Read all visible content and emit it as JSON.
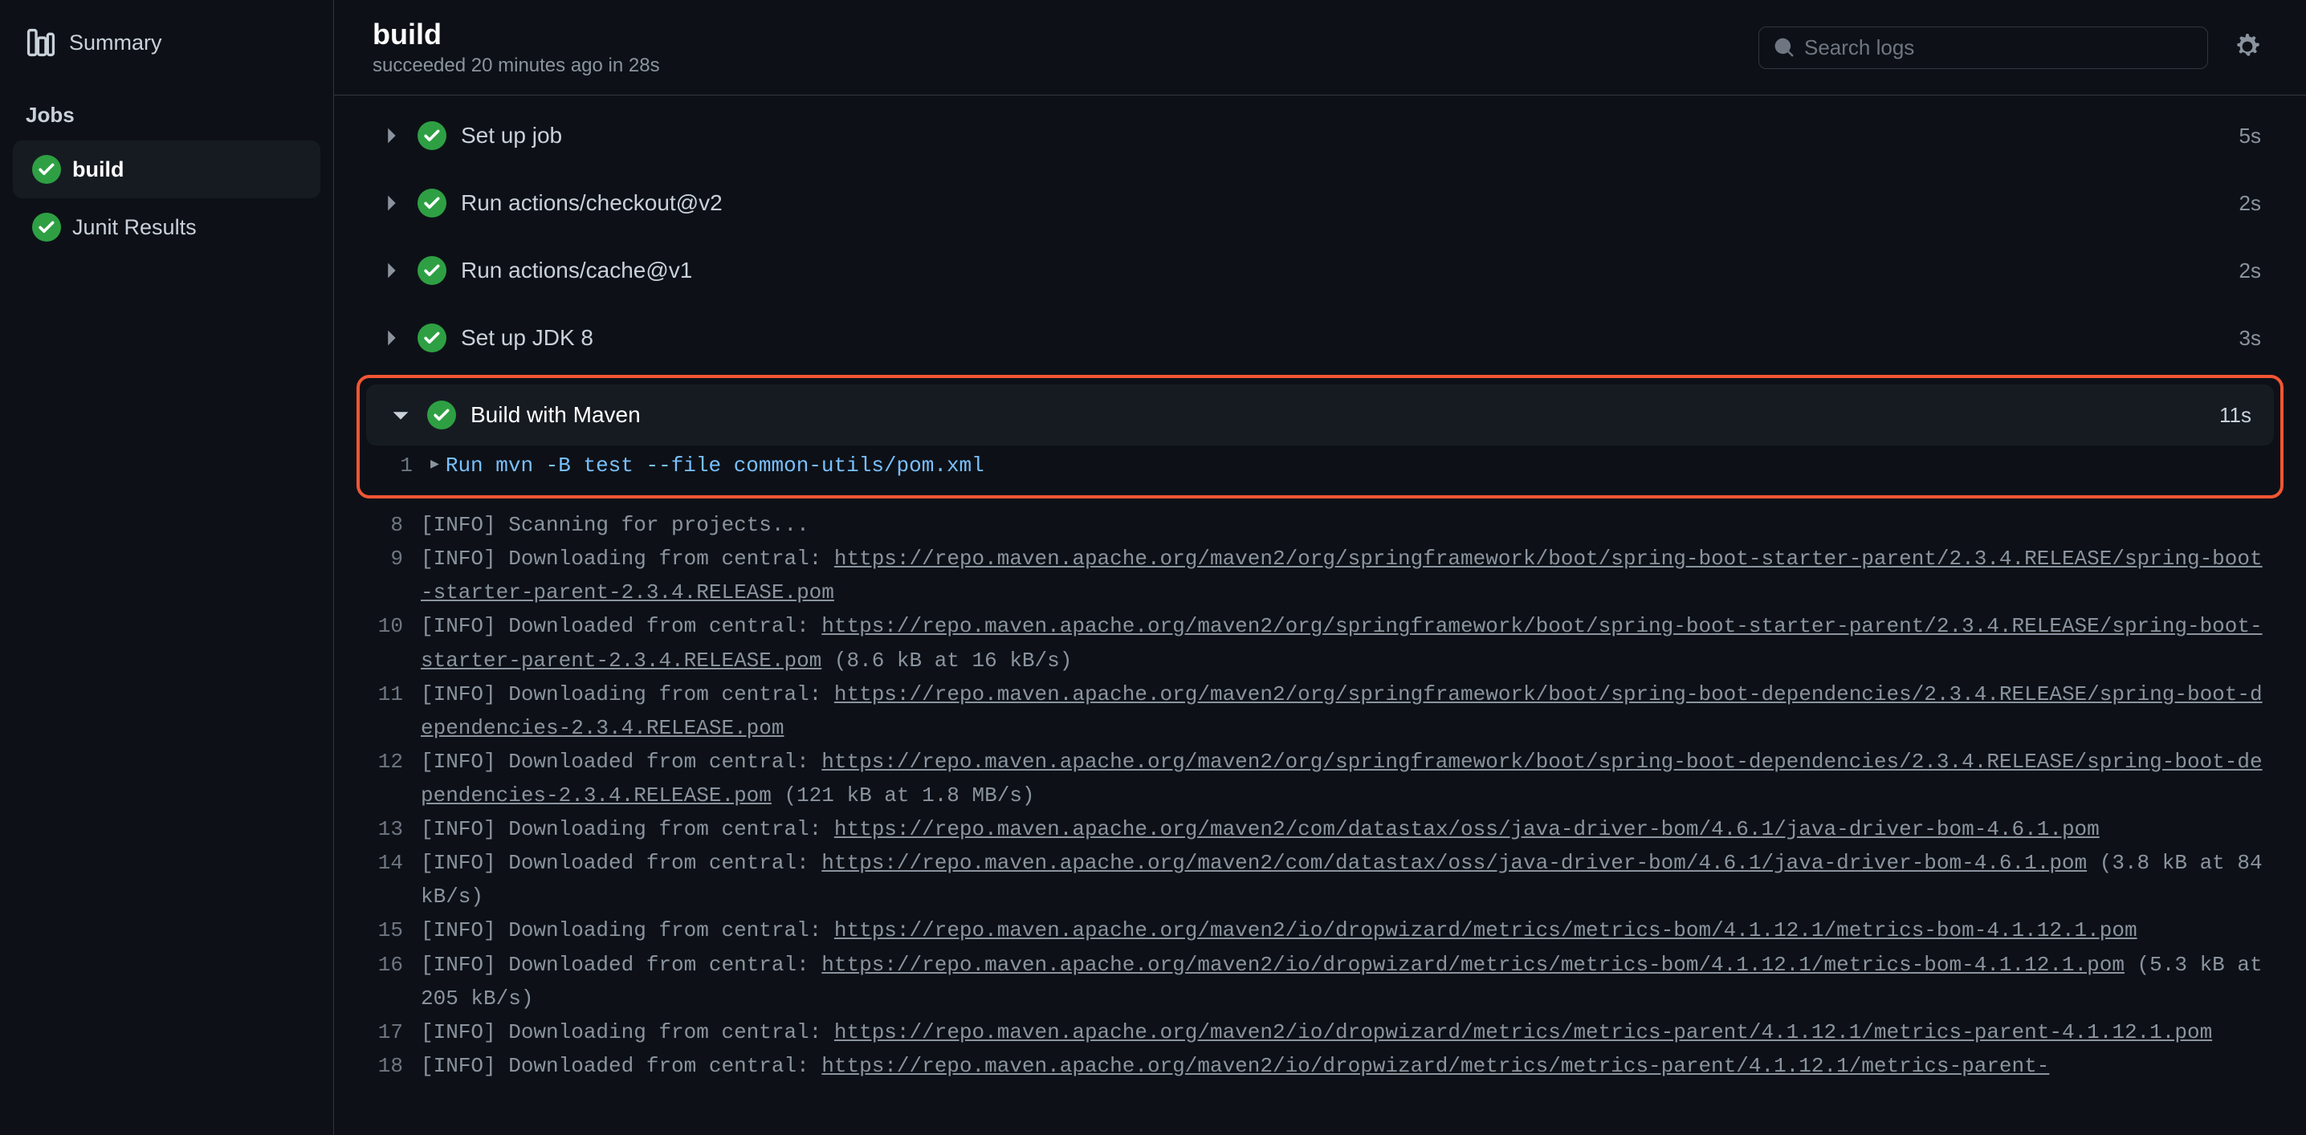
{
  "sidebar": {
    "summary_label": "Summary",
    "jobs_header": "Jobs",
    "jobs": [
      {
        "name": "build"
      },
      {
        "name": "Junit Results"
      }
    ]
  },
  "header": {
    "title": "build",
    "subtitle": "succeeded 20 minutes ago in 28s"
  },
  "search": {
    "placeholder": "Search logs"
  },
  "steps": [
    {
      "name": "Set up job",
      "time": "5s",
      "expanded": false
    },
    {
      "name": "Run actions/checkout@v2",
      "time": "2s",
      "expanded": false
    },
    {
      "name": "Run actions/cache@v1",
      "time": "2s",
      "expanded": false
    },
    {
      "name": "Set up JDK 8",
      "time": "3s",
      "expanded": false
    },
    {
      "name": "Build with Maven",
      "time": "11s",
      "expanded": true
    }
  ],
  "logs": [
    {
      "n": "1",
      "run": true,
      "cmd": "Run mvn -B test --file common-utils/pom.xml"
    },
    {
      "n": "8",
      "prefix": "[INFO] Scanning for projects..."
    },
    {
      "n": "9",
      "prefix": "[INFO] Downloading from central: ",
      "url": "https://repo.maven.apache.org/maven2/org/springframework/boot/spring-boot-starter-parent/2.3.4.RELEASE/spring-boot-starter-parent-2.3.4.RELEASE.pom"
    },
    {
      "n": "10",
      "prefix": "[INFO] Downloaded from central: ",
      "url": "https://repo.maven.apache.org/maven2/org/springframework/boot/spring-boot-starter-parent/2.3.4.RELEASE/spring-boot-starter-parent-2.3.4.RELEASE.pom",
      "suffix": " (8.6 kB at 16 kB/s)"
    },
    {
      "n": "11",
      "prefix": "[INFO] Downloading from central: ",
      "url": "https://repo.maven.apache.org/maven2/org/springframework/boot/spring-boot-dependencies/2.3.4.RELEASE/spring-boot-dependencies-2.3.4.RELEASE.pom"
    },
    {
      "n": "12",
      "prefix": "[INFO] Downloaded from central: ",
      "url": "https://repo.maven.apache.org/maven2/org/springframework/boot/spring-boot-dependencies/2.3.4.RELEASE/spring-boot-dependencies-2.3.4.RELEASE.pom",
      "suffix": " (121 kB at 1.8 MB/s)"
    },
    {
      "n": "13",
      "prefix": "[INFO] Downloading from central: ",
      "url": "https://repo.maven.apache.org/maven2/com/datastax/oss/java-driver-bom/4.6.1/java-driver-bom-4.6.1.pom"
    },
    {
      "n": "14",
      "prefix": "[INFO] Downloaded from central: ",
      "url": "https://repo.maven.apache.org/maven2/com/datastax/oss/java-driver-bom/4.6.1/java-driver-bom-4.6.1.pom",
      "suffix": " (3.8 kB at 84 kB/s)"
    },
    {
      "n": "15",
      "prefix": "[INFO] Downloading from central: ",
      "url": "https://repo.maven.apache.org/maven2/io/dropwizard/metrics/metrics-bom/4.1.12.1/metrics-bom-4.1.12.1.pom"
    },
    {
      "n": "16",
      "prefix": "[INFO] Downloaded from central: ",
      "url": "https://repo.maven.apache.org/maven2/io/dropwizard/metrics/metrics-bom/4.1.12.1/metrics-bom-4.1.12.1.pom",
      "suffix": " (5.3 kB at 205 kB/s)"
    },
    {
      "n": "17",
      "prefix": "[INFO] Downloading from central: ",
      "url": "https://repo.maven.apache.org/maven2/io/dropwizard/metrics/metrics-parent/4.1.12.1/metrics-parent-4.1.12.1.pom"
    },
    {
      "n": "18",
      "prefix": "[INFO] Downloaded from central: ",
      "url": "https://repo.maven.apache.org/maven2/io/dropwizard/metrics/metrics-parent/4.1.12.1/metrics-parent-"
    }
  ]
}
